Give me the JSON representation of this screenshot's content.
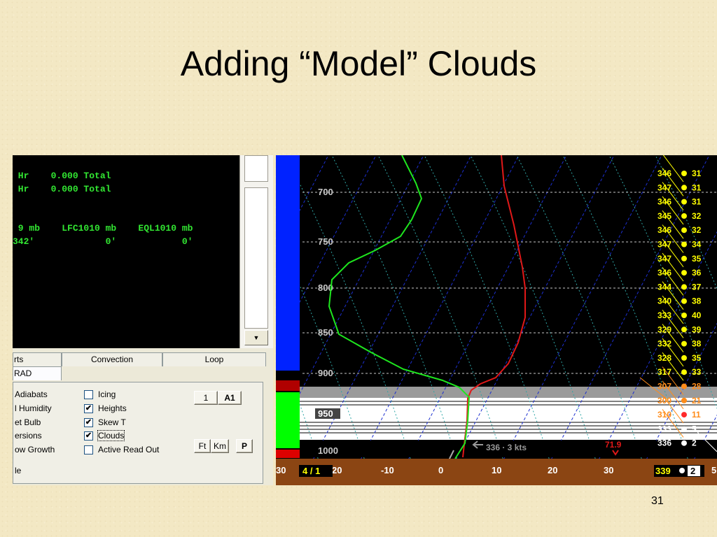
{
  "slide": {
    "title": "Adding “Model” Clouds",
    "number": "31"
  },
  "console": {
    "lines": [
      " Hr    0.000 Total",
      " Hr    0.000 Total",
      " 9 mb    LFC1010 mb    EQL1010 mb",
      "342'             0'            0'"
    ]
  },
  "tabs": {
    "t0": "rts",
    "t1": "Convection",
    "t2": "Loop",
    "t3": "RAD"
  },
  "options": {
    "left": [
      " Adiabats",
      "l Humidity",
      "et Bulb",
      "ersions",
      "ow Growth"
    ],
    "icing": "Icing",
    "icing_checked": false,
    "heights": "Heights",
    "heights_checked": true,
    "skewt": "Skew T",
    "skewt_checked": true,
    "clouds": "Clouds",
    "clouds_checked": true,
    "active_read_out": "Active Read Out",
    "active_read_out_checked": false,
    "bottom_left": "le"
  },
  "buttons": {
    "b1": "1",
    "a1": "A1",
    "ft": "Ft",
    "km": "Km",
    "p": "P"
  },
  "check_glyph": "✔",
  "skewt": {
    "pressures": [
      "700",
      "750",
      "800",
      "850",
      "900",
      "950",
      "1000"
    ],
    "temps": [
      "30",
      "20",
      "-10",
      "0",
      "10",
      "20",
      "30",
      "5"
    ],
    "date": "4 / 1",
    "surface_wind": "336 · 3 kts",
    "surface_temp": "71.9",
    "surface_value": "339",
    "surface_speed": "2",
    "wind_column": [
      {
        "dir": "346",
        "spd": "31"
      },
      {
        "dir": "347",
        "spd": "31"
      },
      {
        "dir": "346",
        "spd": "31"
      },
      {
        "dir": "345",
        "spd": "32"
      },
      {
        "dir": "346",
        "spd": "32"
      },
      {
        "dir": "347",
        "spd": "34"
      },
      {
        "dir": "347",
        "spd": "35"
      },
      {
        "dir": "346",
        "spd": "36"
      },
      {
        "dir": "344",
        "spd": "37"
      },
      {
        "dir": "340",
        "spd": "38"
      },
      {
        "dir": "333",
        "spd": "40"
      },
      {
        "dir": "329",
        "spd": "39"
      },
      {
        "dir": "332",
        "spd": "38"
      },
      {
        "dir": "328",
        "spd": "35"
      },
      {
        "dir": "317",
        "spd": "33"
      },
      {
        "dir": "307",
        "spd": "28"
      },
      {
        "dir": "300",
        "spd": "21"
      },
      {
        "dir": "310",
        "spd": "11"
      },
      {
        "dir": "333",
        "spd": "5"
      },
      {
        "dir": "336",
        "spd": "2"
      }
    ]
  },
  "colors": {
    "temp_line": "#e01818",
    "dewpoint_line": "#1ee61e",
    "isotherm": "#1c2fd0",
    "dry_adiabat": "#2fa6a6",
    "wind_text": "#ffff00",
    "ground": "#8b4513",
    "bar_blue": "#0022ff",
    "bar_green": "#00ff00",
    "bar_red": "#dd0000"
  }
}
